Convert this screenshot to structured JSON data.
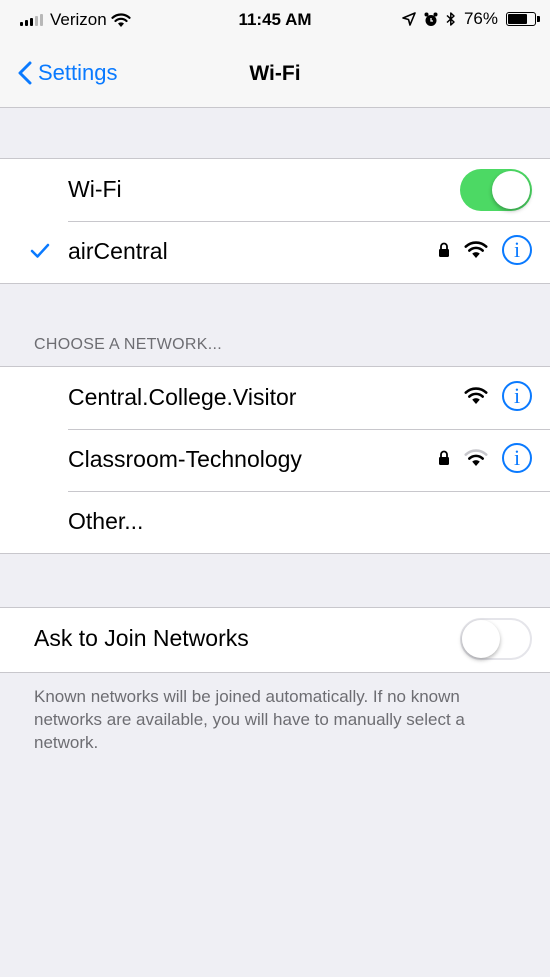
{
  "status_bar": {
    "carrier": "Verizon",
    "time": "11:45 AM",
    "battery_percent": "76%",
    "battery_level": 0.76,
    "icons": [
      "signal-icon",
      "wifi-icon",
      "location-icon",
      "alarm-icon",
      "bluetooth-icon",
      "battery-icon"
    ]
  },
  "nav": {
    "back_label": "Settings",
    "title": "Wi-Fi"
  },
  "wifi_group": {
    "wifi_label": "Wi-Fi",
    "wifi_enabled": true,
    "connected_network": "airCentral"
  },
  "networks": {
    "header": "CHOOSE A NETWORK...",
    "items": [
      {
        "name": "Central.College.Visitor",
        "secured": false
      },
      {
        "name": "Classroom-Technology",
        "secured": true
      }
    ],
    "other_label": "Other..."
  },
  "ask_to_join": {
    "label": "Ask to Join Networks",
    "enabled": false,
    "description": "Known networks will be joined automatically. If no known networks are available, you will have to manually select a network."
  },
  "colors": {
    "accent": "#0a7aff",
    "toggle_on": "#4cd964",
    "background": "#efeff4"
  }
}
